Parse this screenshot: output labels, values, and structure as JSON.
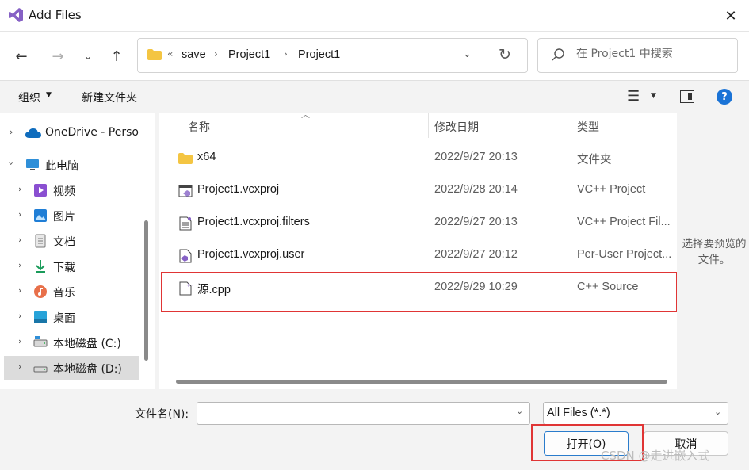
{
  "window": {
    "title": "Add Files"
  },
  "address": {
    "overflow": "«",
    "crumbs": [
      "save",
      "Project1",
      "Project1"
    ]
  },
  "search": {
    "placeholder": "在 Project1 中搜索"
  },
  "toolbar": {
    "organize": "组织",
    "new_folder": "新建文件夹"
  },
  "sidebar": {
    "items": [
      {
        "label": "OneDrive - Perso",
        "icon": "onedrive-cloud-icon"
      },
      {
        "label": "此电脑",
        "icon": "this-pc-icon"
      },
      {
        "label": "视频",
        "icon": "videos-folder-icon"
      },
      {
        "label": "图片",
        "icon": "pictures-folder-icon"
      },
      {
        "label": "文档",
        "icon": "documents-folder-icon"
      },
      {
        "label": "下载",
        "icon": "downloads-folder-icon"
      },
      {
        "label": "音乐",
        "icon": "music-folder-icon"
      },
      {
        "label": "桌面",
        "icon": "desktop-folder-icon"
      },
      {
        "label": "本地磁盘 (C:)",
        "icon": "drive-icon"
      },
      {
        "label": "本地磁盘 (D:)",
        "icon": "drive-icon"
      }
    ]
  },
  "columns": {
    "name": "名称",
    "date": "修改日期",
    "type": "类型"
  },
  "files": [
    {
      "name": "x64",
      "date": "2022/9/27 20:13",
      "type": "文件夹",
      "icon": "folder-icon"
    },
    {
      "name": "Project1.vcxproj",
      "date": "2022/9/28 20:14",
      "type": "VC++ Project",
      "icon": "vcxproj-file-icon"
    },
    {
      "name": "Project1.vcxproj.filters",
      "date": "2022/9/27 20:13",
      "type": "VC++ Project Fil...",
      "icon": "filters-file-icon"
    },
    {
      "name": "Project1.vcxproj.user",
      "date": "2022/9/27 20:12",
      "type": "Per-User Project...",
      "icon": "user-file-icon"
    },
    {
      "name": "源.cpp",
      "date": "2022/9/29 10:29",
      "type": "C++ Source",
      "icon": "cpp-file-icon"
    }
  ],
  "preview": {
    "text": "选择要预览的文件。"
  },
  "bottom": {
    "filename_label": "文件名(N):",
    "filename_value": "",
    "filetype": "All Files (*.*)",
    "open": "打开(O)",
    "cancel": "取消"
  },
  "watermark": "CSDN @走进嵌入式",
  "colors": {
    "accent": "#1a73d6",
    "highlight": "#e03535",
    "folder": "#f4c542"
  }
}
